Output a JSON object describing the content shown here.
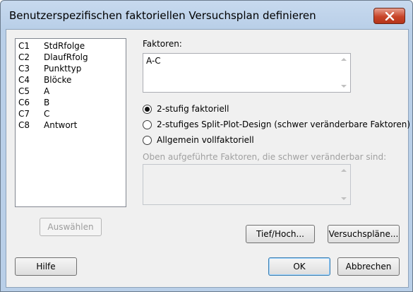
{
  "window": {
    "title": "Benutzerspezifischen faktoriellen Versuchsplan definieren"
  },
  "columns": [
    {
      "id": "C1",
      "name": "StdRfolge"
    },
    {
      "id": "C2",
      "name": "DlaufRfolg"
    },
    {
      "id": "C3",
      "name": "Punkttyp"
    },
    {
      "id": "C4",
      "name": "Blöcke"
    },
    {
      "id": "C5",
      "name": "A"
    },
    {
      "id": "C6",
      "name": "B"
    },
    {
      "id": "C7",
      "name": "C"
    },
    {
      "id": "C8",
      "name": "Antwort"
    }
  ],
  "factors": {
    "label": "Faktoren:",
    "value": "A-C"
  },
  "design_options": [
    {
      "label": "2-stufig faktoriell",
      "checked": true
    },
    {
      "label": "2-stufiges Split-Plot-Design (schwer veränderbare Faktoren)",
      "checked": false
    },
    {
      "label": "Allgemein vollfaktoriell",
      "checked": false
    }
  ],
  "hard_to_change": {
    "label": "Oben aufgeführte Faktoren, die schwer veränderbar sind:",
    "value": ""
  },
  "buttons": {
    "select": "Auswählen",
    "low_high": "Tief/Hoch...",
    "designs": "Versuchspläne...",
    "help": "Hilfe",
    "ok": "OK",
    "cancel": "Abbrechen"
  }
}
